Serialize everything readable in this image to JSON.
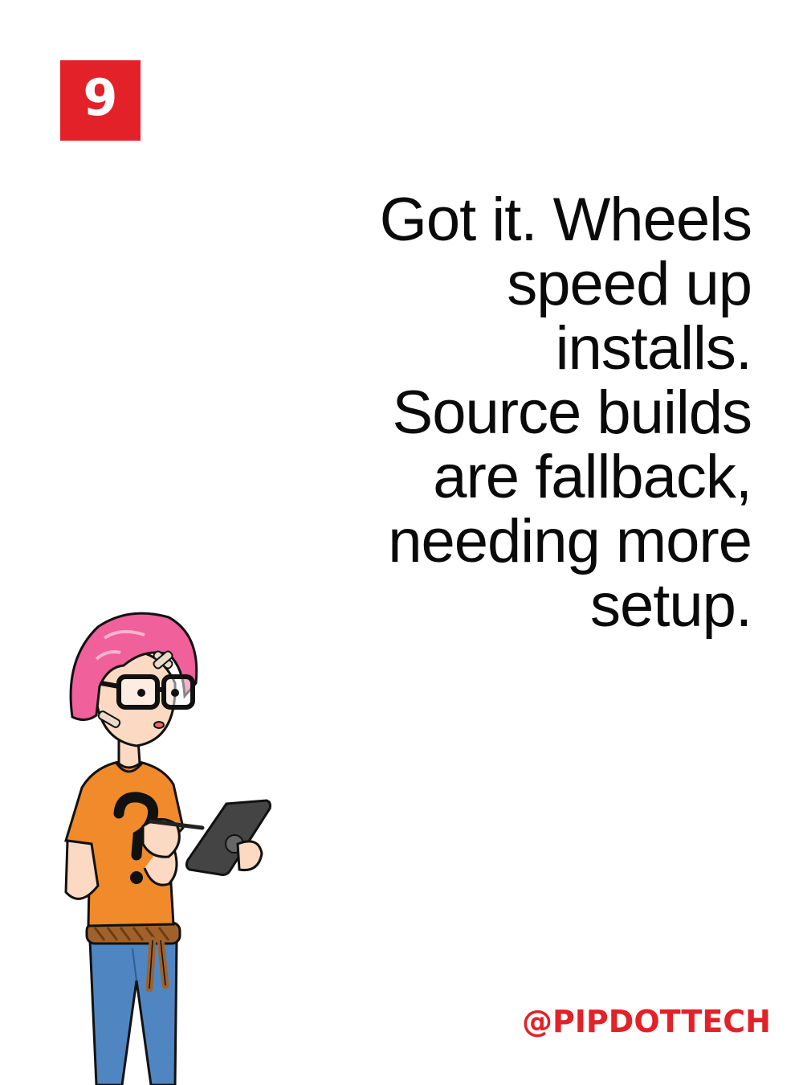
{
  "page_number": "9",
  "message_lines": [
    "Got it. Wheels",
    "speed up",
    "installs.",
    "Source builds",
    "are fallback,",
    "needing more",
    "setup."
  ],
  "handle": "@PIPDOTTECH",
  "colors": {
    "accent": "#e32128",
    "text": "#0a0a0a",
    "background": "#ffffff",
    "hair": "#f0609a",
    "shirt": "#f08a2a",
    "jeans": "#4f86c2",
    "tablet": "#444444"
  },
  "illustration": {
    "character": "pink-haired-person-with-glasses-holding-tablet"
  }
}
